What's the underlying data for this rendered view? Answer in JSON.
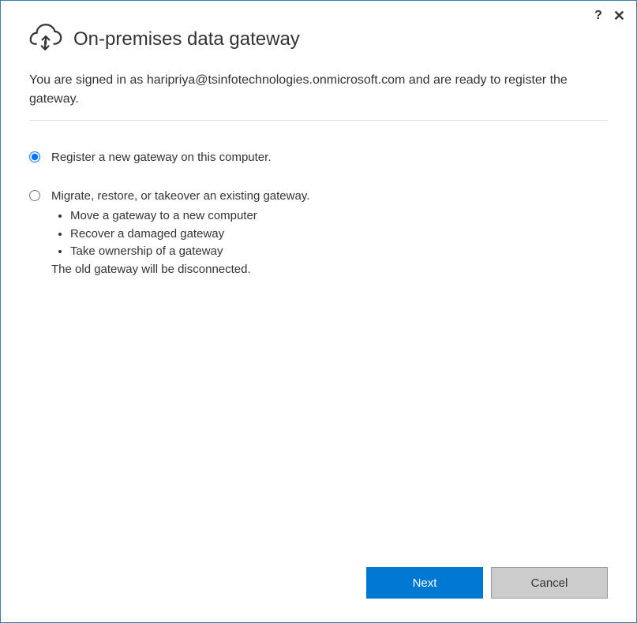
{
  "title": "On-premises data gateway",
  "subtitle": "You are signed in as haripriya@tsinfotechnologies.onmicrosoft.com and are ready to register the gateway.",
  "options": {
    "register": {
      "label": "Register a new gateway on this computer.",
      "checked": true
    },
    "migrate": {
      "label": "Migrate, restore, or takeover an existing gateway.",
      "checked": false,
      "bullets": [
        "Move a gateway to a new computer",
        "Recover a damaged gateway",
        "Take ownership of a gateway"
      ],
      "note": "The old gateway will be disconnected."
    }
  },
  "buttons": {
    "next": "Next",
    "cancel": "Cancel"
  },
  "icons": {
    "help": "?",
    "close": "✕"
  }
}
